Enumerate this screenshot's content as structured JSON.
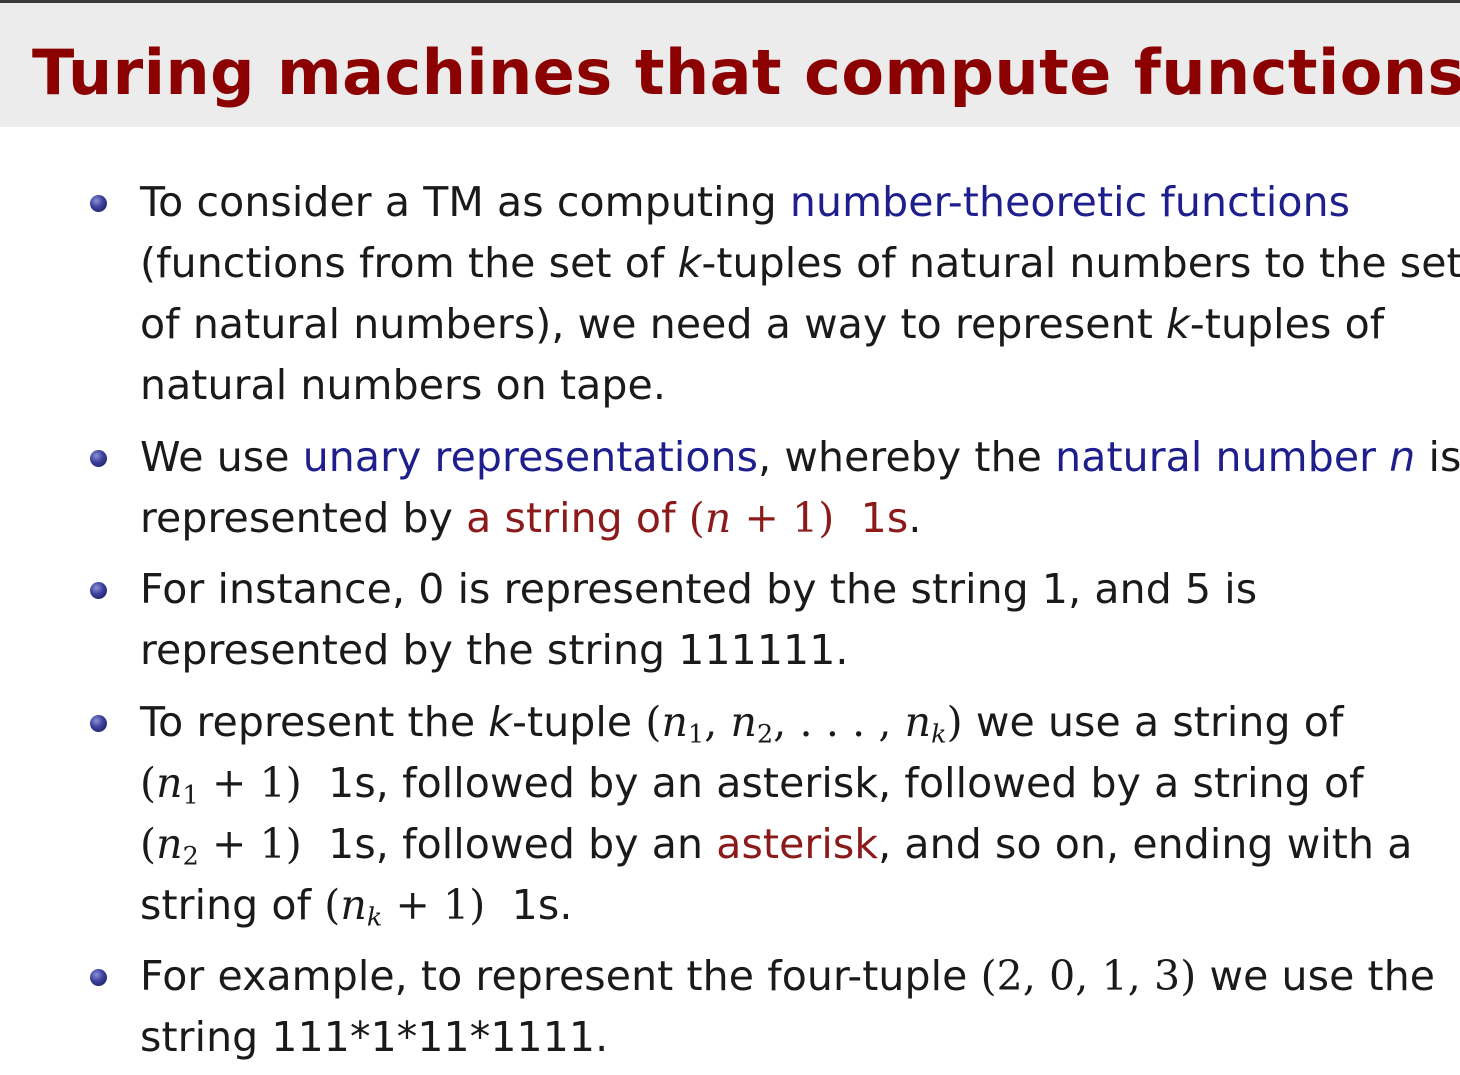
{
  "title": "Turing machines that compute functions",
  "colors": {
    "title": "#8b0000",
    "term_blue": "#1e1e8c",
    "term_red": "#8b1a1a",
    "text": "#1a1a1a",
    "titlebar_bg": "#ececec",
    "bullet": "#3a3e9a"
  },
  "bullets": [
    {
      "lines": [
        {
          "a": "To consider a TM as computing ",
          "term": "number-theoretic functions"
        },
        {
          "a": "(functions from the set of ",
          "k": "k",
          "b": "-tuples of natural numbers to the set"
        },
        {
          "a": "of natural numbers), we need a way to represent ",
          "k": "k",
          "b": "-tuples of"
        },
        {
          "a": "natural numbers on tape."
        }
      ]
    },
    {
      "lines": [
        {
          "a": "We use ",
          "term1": "unary representations",
          "b": ", whereby the ",
          "term2": "natural number",
          "n": "n",
          "c": " is"
        },
        {
          "a": "represented by ",
          "red": "a string of ",
          "math": "(n + 1)",
          "red2": "1s",
          "b": "."
        }
      ]
    },
    {
      "lines": [
        {
          "a": "For instance, 0 is represented by the string 1, and 5 is"
        },
        {
          "a": "represented by the string 111111."
        }
      ]
    },
    {
      "lines": [
        {
          "a": "To represent the ",
          "k": "k",
          "b": "-tuple ",
          "tuple": "(n1, n2, . . . , nk)",
          "c": " we use a string of"
        },
        {
          "m": "(n1 + 1)",
          "b": "1s, followed by an asterisk, followed by a string of"
        },
        {
          "m": "(n2 + 1)",
          "b": "1s, followed by an ",
          "term": "asterisk",
          "c": ", and so on, ending with a"
        },
        {
          "a": "string of ",
          "m": "(nk + 1)",
          "b": "1s."
        }
      ]
    },
    {
      "lines": [
        {
          "a": "For example, to represent the four-tuple ",
          "m": "(2, 0, 1, 3)",
          "b": " we use the"
        },
        {
          "a": "string 111*1*11*1111."
        }
      ]
    }
  ]
}
